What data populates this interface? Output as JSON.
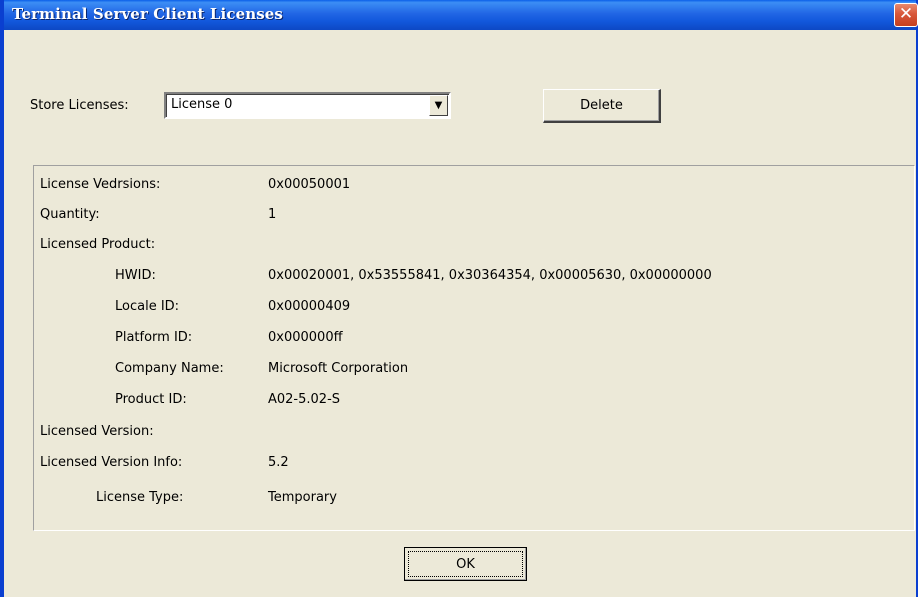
{
  "window": {
    "title": "Terminal Server Client Licenses",
    "close_glyph": "✕"
  },
  "store": {
    "label": "Store Licenses:",
    "selected": "License 0",
    "dropdown_glyph": "▼"
  },
  "buttons": {
    "delete": "Delete",
    "ok": "OK"
  },
  "details": {
    "license_versions_label": "License Vedrsions:",
    "license_versions_value": "0x00050001",
    "quantity_label": "Quantity:",
    "quantity_value": "1",
    "licensed_product_label": "Licensed Product:",
    "hwid_label": "HWID:",
    "hwid_value": "0x00020001, 0x53555841, 0x30364354, 0x00005630, 0x00000000",
    "locale_label": "Locale ID:",
    "locale_value": "0x00000409",
    "platform_label": "Platform ID:",
    "platform_value": "0x000000ff",
    "company_label": "Company Name:",
    "company_value": "Microsoft Corporation",
    "product_id_label": "Product ID:",
    "product_id_value": "A02-5.02-S",
    "licensed_version_label": "Licensed Version:",
    "licensed_version_info_label": "Licensed Version Info:",
    "licensed_version_info_value": "5.2",
    "license_type_label": "License Type:",
    "license_type_value": "Temporary"
  },
  "colors": {
    "titlebar": "#1258dc",
    "face": "#ece9d8",
    "close": "#d8573a"
  }
}
